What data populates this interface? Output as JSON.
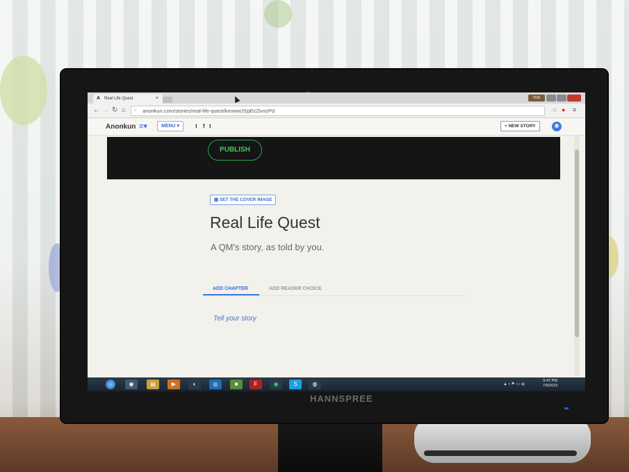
{
  "browser": {
    "tab_title": "Real Life Quest",
    "tab_close": "×",
    "url": "anonkun.com/stories/real-life-quest/kevwxtJSpEcZivxzPd",
    "window_user": "YOU"
  },
  "site_nav": {
    "logo": "Anonkun",
    "hamburger": "≡▾",
    "menu_label": "MENU ▾",
    "social": [
      "t",
      "f",
      "t"
    ],
    "new_story_label": "+ NEW STORY"
  },
  "hero": {
    "publish_label": "PUBLISH"
  },
  "story": {
    "cover_button_label": "SET THE COVER IMAGE",
    "title": "Real Life Quest",
    "subtitle": "A QM's story, as told by you."
  },
  "content_tabs": [
    {
      "label": "ADD CHAPTER",
      "active": true
    },
    {
      "label": "ADD READER CHOICE",
      "active": false
    }
  ],
  "editor": {
    "placeholder": "Tell your story"
  },
  "taskbar": {
    "time": "5:47 PM",
    "date": "7/5/2015"
  },
  "monitor": {
    "brand": "HANNSPREE"
  },
  "colors": {
    "accent": "#3a6fd6",
    "publish_green": "#3ecb5f",
    "hero_bg": "#151515"
  }
}
